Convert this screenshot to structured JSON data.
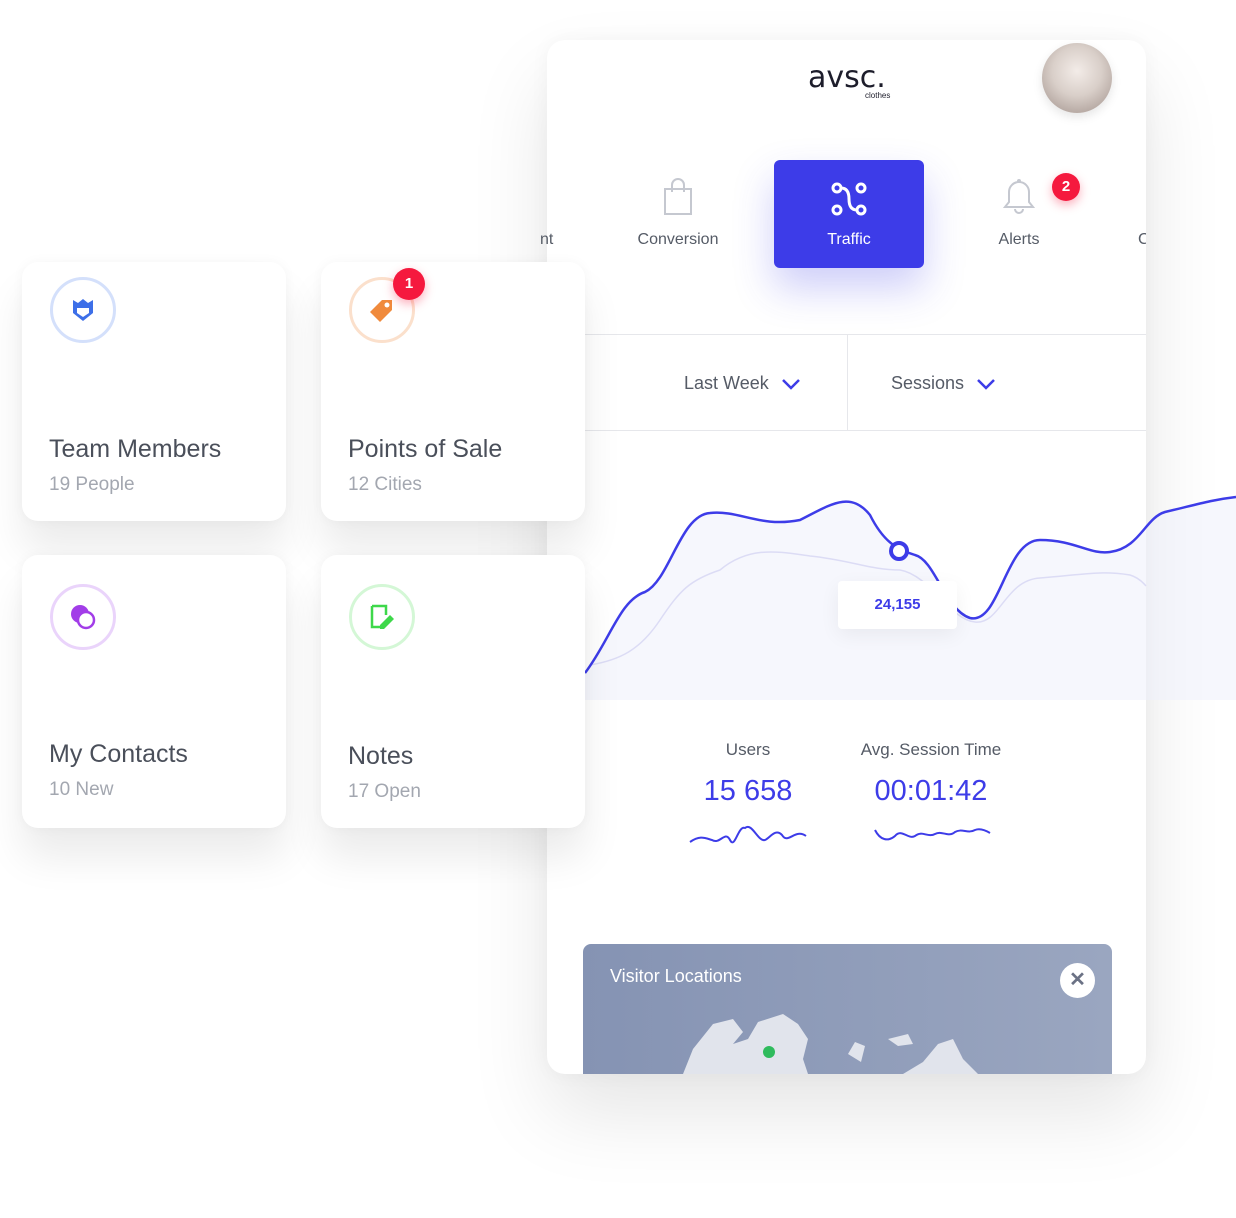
{
  "brand": {
    "name": "avsc.",
    "tagline": "clothes"
  },
  "tabs": [
    {
      "label": "nt",
      "icon": "partial-tab",
      "active": false
    },
    {
      "label": "Conversion",
      "icon": "shopping-bag-icon",
      "active": false
    },
    {
      "label": "Traffic",
      "icon": "route-icon",
      "active": true
    },
    {
      "label": "Alerts",
      "icon": "bell-icon",
      "active": false,
      "badge": "2"
    },
    {
      "label": "C",
      "icon": "partial-tab",
      "active": false
    }
  ],
  "filters": {
    "period": "Last Week",
    "metric": "Sessions"
  },
  "chart": {
    "tooltip": "24,155"
  },
  "stats": [
    {
      "label": "Users",
      "value": "15 658"
    },
    {
      "label": "Avg. Session Time",
      "value": "00:01:42"
    }
  ],
  "map": {
    "title": "Visitor Locations"
  },
  "cards": [
    {
      "title": "Team Members",
      "sub": "19 People",
      "icon": "shield-icon",
      "color": "#3d6fe8"
    },
    {
      "title": "Points of Sale",
      "sub": "12 Cities",
      "icon": "tag-icon",
      "color": "#f08a3c",
      "badge": "1"
    },
    {
      "title": "My Contacts",
      "sub": "10 New",
      "icon": "chat-icon",
      "color": "#a23de8"
    },
    {
      "title": "Notes",
      "sub": "17 Open",
      "icon": "note-icon",
      "color": "#3ed84a"
    }
  ],
  "colors": {
    "accent": "#3d3ce8",
    "badge": "#f5193e"
  }
}
